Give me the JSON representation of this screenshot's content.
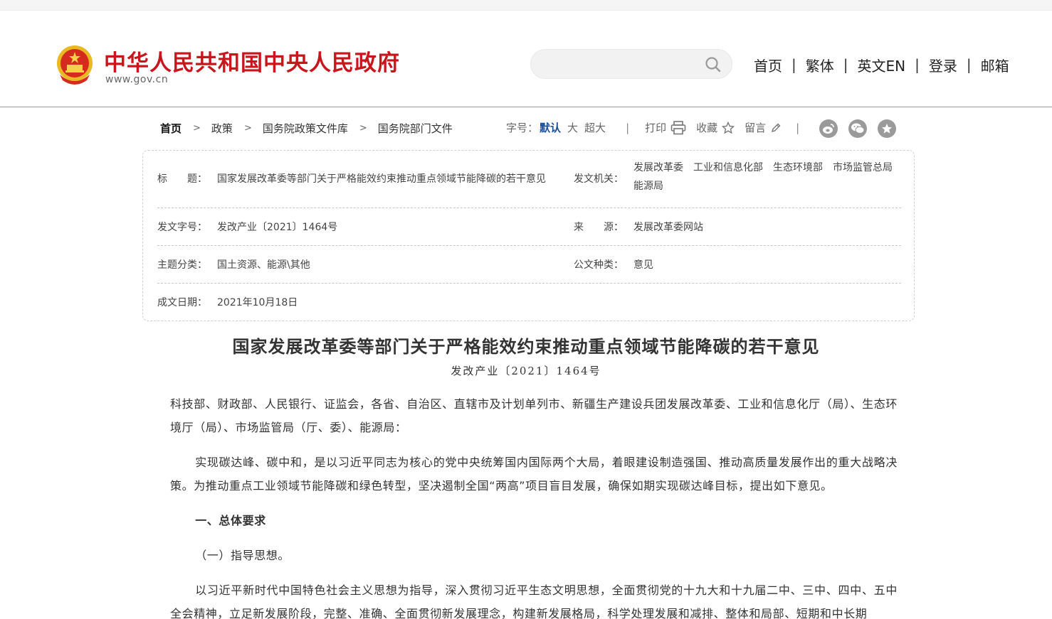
{
  "header": {
    "site_title": "中华人民共和国中央人民政府",
    "site_url": "www.gov.cn",
    "search": {
      "value": "",
      "placeholder": ""
    },
    "nav": [
      "首页",
      "繁体",
      "英文EN",
      "登录",
      "邮箱"
    ],
    "colors": {
      "brand_red": "#c8161d",
      "link_blue": "#1a4f9c"
    }
  },
  "breadcrumb": [
    "首页",
    "政策",
    "国务院政策文件库",
    "国务院部门文件"
  ],
  "tools": {
    "font_label": "字号：",
    "font_default": "默认",
    "font_large": "大",
    "font_xlarge": "超大",
    "print": "打印",
    "favorite": "收藏",
    "comment": "留言",
    "share_icons": [
      "weibo-icon",
      "wechat-icon",
      "star-icon"
    ]
  },
  "info": {
    "title_label": "标　　题：",
    "title_value": "国家发展改革委等部门关于严格能效约束推动重点领域节能降碳的若干意见",
    "issuer_label": "发文机关：",
    "issuer_value": "发展改革委　工业和信息化部　生态环境部　市场监管总局　能源局",
    "docno_label": "发文字号：",
    "docno_value": "发改产业〔2021〕1464号",
    "source_label": "来　　源：",
    "source_value": "发展改革委网站",
    "topic_label": "主题分类：",
    "topic_value": "国土资源、能源\\其他",
    "type_label": "公文种类：",
    "type_value": "意见",
    "date_label": "成文日期：",
    "date_value": "2021年10月18日"
  },
  "document": {
    "title": "国家发展改革委等部门关于严格能效约束推动重点领域节能降碳的若干意见",
    "number": "发改产业〔2021〕1464号",
    "salutation": "科技部、财政部、人民银行、证监会，各省、自治区、直辖市及计划单列市、新疆生产建设兵团发展改革委、工业和信息化厅（局）、生态环境厅（局）、市场监管局（厅、委）、能源局：",
    "para1": "实现碳达峰、碳中和，是以习近平同志为核心的党中央统筹国内国际两个大局，着眼建设制造强国、推动高质量发展作出的重大战略决策。为推动重点工业领域节能降碳和绿色转型，坚决遏制全国“两高”项目盲目发展，确保如期实现碳达峰目标，提出如下意见。",
    "heading1": "一、总体要求",
    "heading2": "（一）指导思想。",
    "para2": "以习近平新时代中国特色社会主义思想为指导，深入贯彻习近平生态文明思想，全面贯彻党的十九大和十九届二中、三中、四中、五中全会精神，立足新发展阶段，完整、准确、全面贯彻新发展理念，构建新发展格局，科学处理发展和减排、整体和局部、短期和中长期"
  }
}
